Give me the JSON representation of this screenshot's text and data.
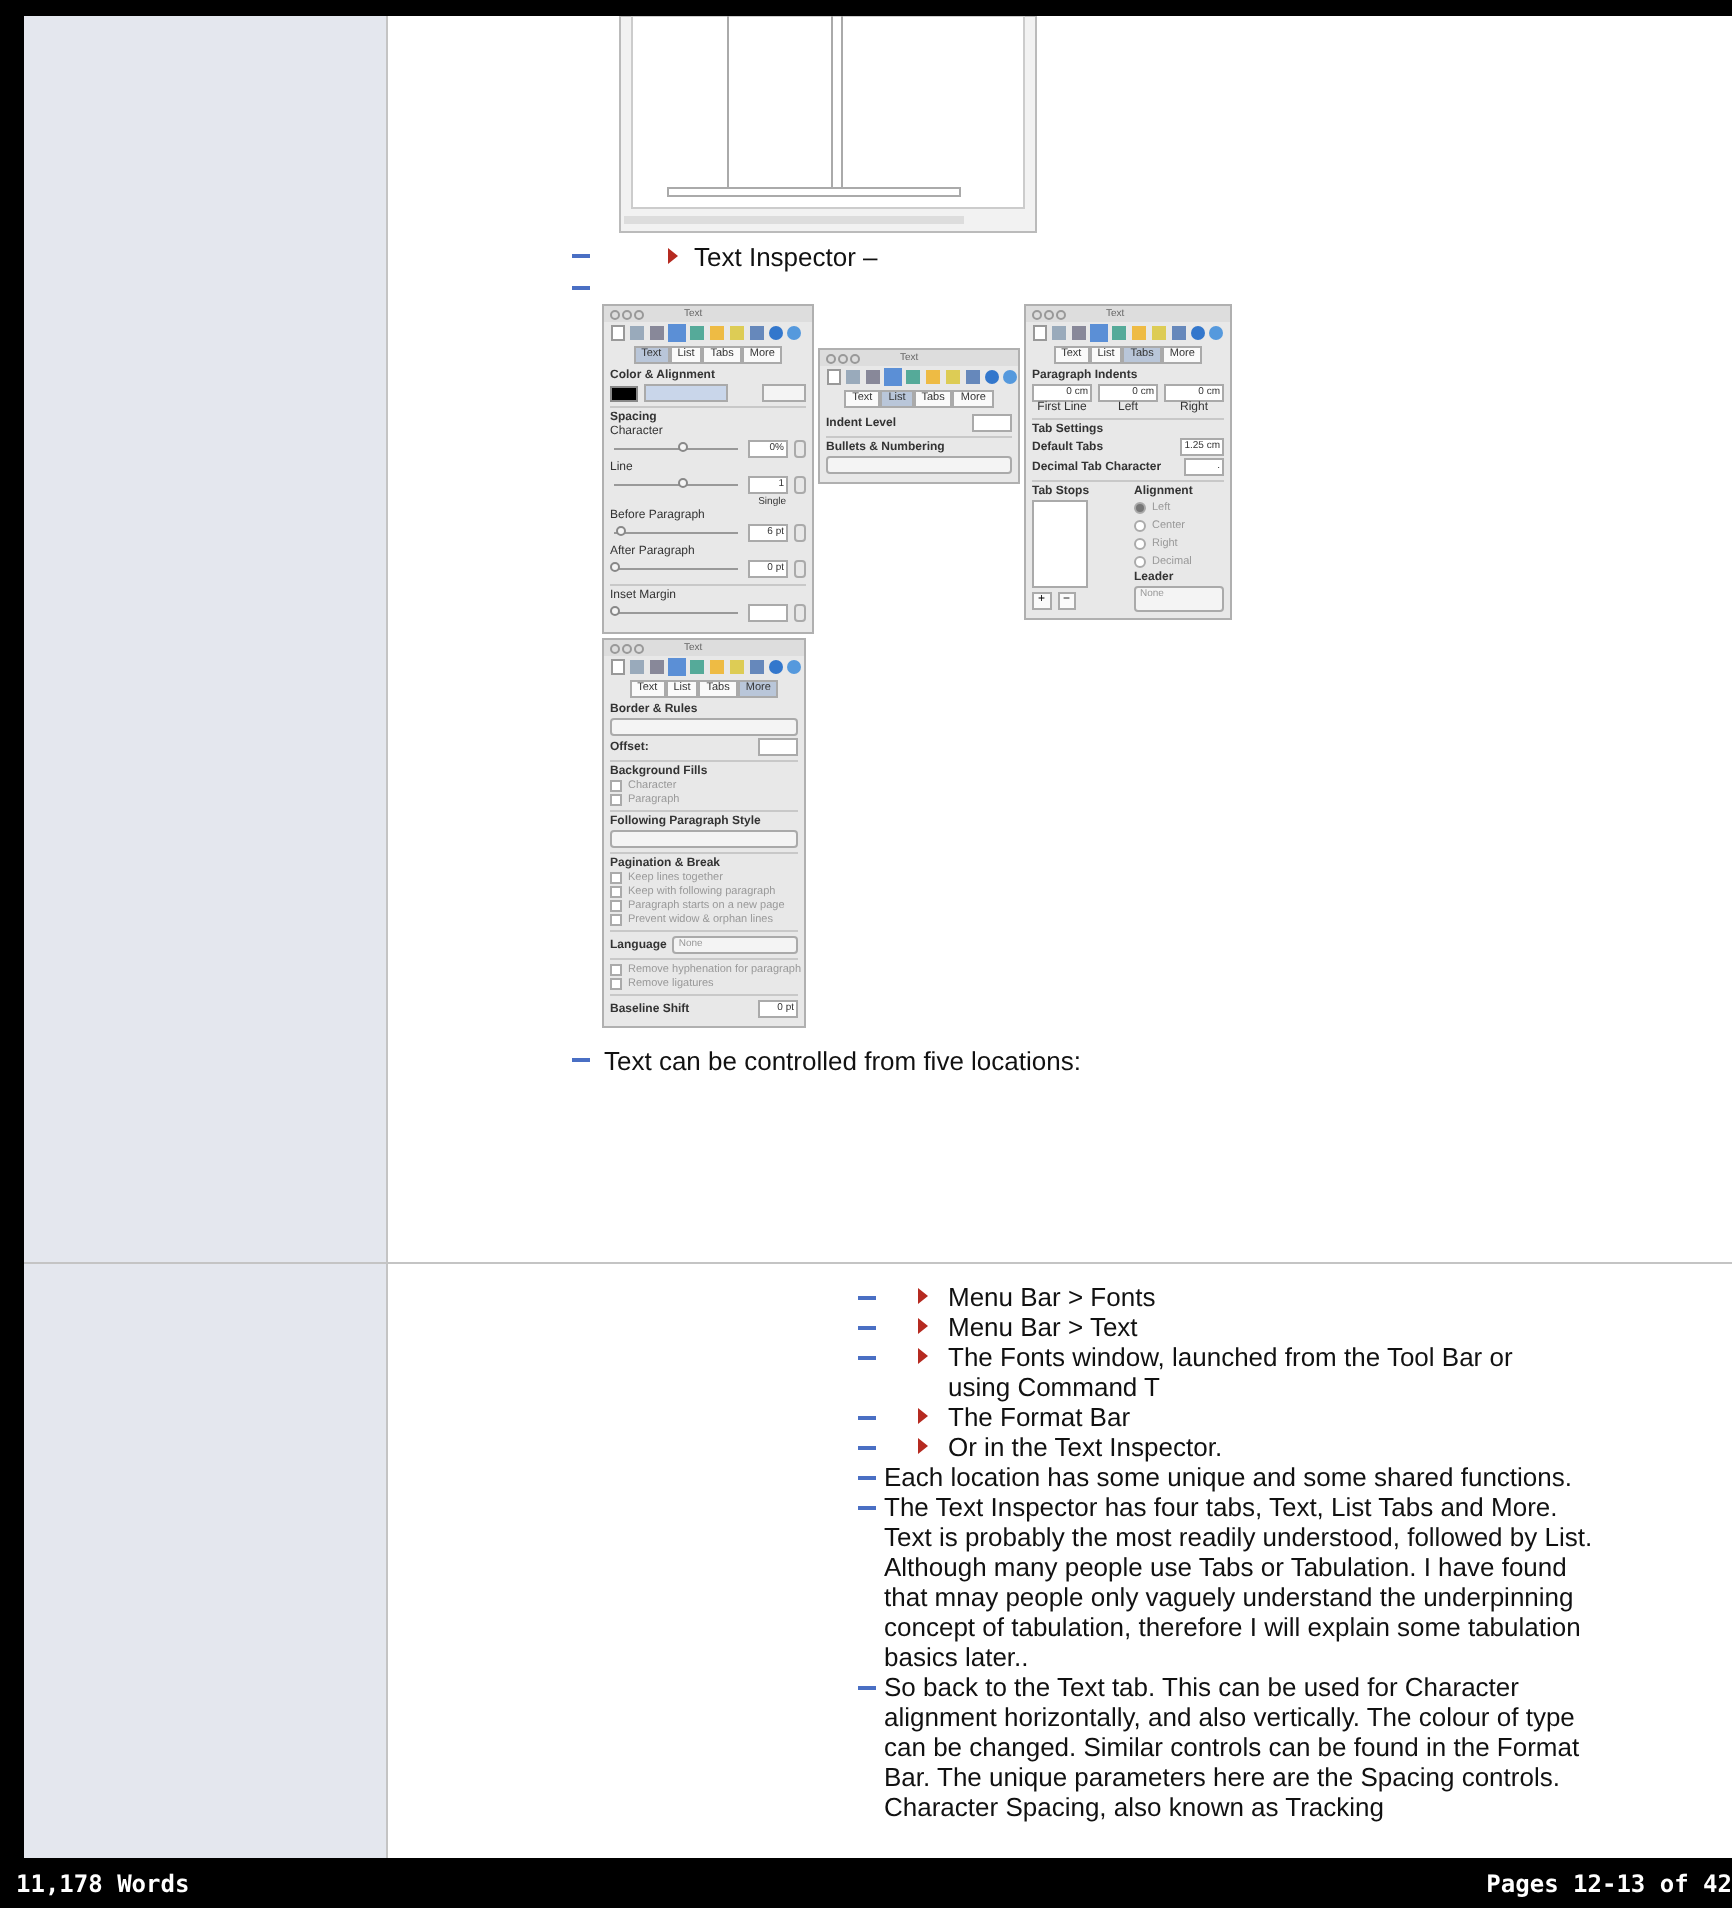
{
  "upper_section": {
    "items": [
      {
        "kind": "subbullet",
        "text": "Text Inspector –"
      },
      {
        "kind": "empty_bullet"
      }
    ],
    "panels": [
      {
        "title": "Text",
        "tabs": [
          {
            "label": "Text",
            "selected": true
          },
          {
            "label": "List",
            "selected": false
          },
          {
            "label": "Tabs",
            "selected": false
          },
          {
            "label": "More",
            "selected": false
          }
        ],
        "rows": [
          {
            "kind": "heading",
            "text": "Color & Alignment"
          },
          {
            "kind": "colorrow"
          },
          {
            "kind": "divider"
          },
          {
            "kind": "heading",
            "text": "Spacing"
          },
          {
            "kind": "slider",
            "label": "Character",
            "level": 0.55,
            "value": "0%"
          },
          {
            "kind": "slider",
            "label": "Line",
            "level": 0.55,
            "value": "1",
            "note": "Single"
          },
          {
            "kind": "slider",
            "label": "Before Paragraph",
            "level": 0.05,
            "value": "6 pt"
          },
          {
            "kind": "slider",
            "label": "After Paragraph",
            "level": 0.0,
            "value": "0 pt"
          },
          {
            "kind": "divider"
          },
          {
            "kind": "slider",
            "label": "Inset Margin",
            "level": 0.0
          }
        ]
      },
      {
        "title": "Text",
        "tabs": [
          {
            "label": "Text",
            "selected": false
          },
          {
            "label": "List",
            "selected": true
          },
          {
            "label": "Tabs",
            "selected": false
          },
          {
            "label": "More",
            "selected": false
          }
        ],
        "rows": [
          {
            "kind": "field",
            "label": "Indent Level"
          },
          {
            "kind": "divider"
          },
          {
            "kind": "heading",
            "text": "Bullets & Numbering"
          },
          {
            "kind": "select"
          }
        ]
      },
      {
        "title": "Text",
        "tabs": [
          {
            "label": "Text",
            "selected": false
          },
          {
            "label": "List",
            "selected": false
          },
          {
            "label": "Tabs",
            "selected": true
          },
          {
            "label": "More",
            "selected": false
          }
        ],
        "rows": [
          {
            "kind": "heading",
            "text": "Paragraph Indents"
          },
          {
            "kind": "fields3",
            "items": [
              {
                "value": "0 cm",
                "label": "First Line"
              },
              {
                "value": "0 cm",
                "label": "Left"
              },
              {
                "value": "0 cm",
                "label": "Right"
              }
            ]
          },
          {
            "kind": "divider"
          },
          {
            "kind": "heading",
            "text": "Tab Settings"
          },
          {
            "kind": "field",
            "label": "Default Tabs",
            "value": "1.25 cm"
          },
          {
            "kind": "field",
            "label": "Decimal Tab Character",
            "value": "."
          },
          {
            "kind": "divider"
          },
          {
            "kind": "tabstops",
            "label": "Tab Stops",
            "alignment_label": "Alignment",
            "options": [
              {
                "label": "Left",
                "selected": true
              },
              {
                "label": "Center",
                "selected": false
              },
              {
                "label": "Right",
                "selected": false
              },
              {
                "label": "Decimal",
                "selected": false
              }
            ],
            "leader_label": "Leader",
            "leader_value": "None",
            "buttons": [
              "+",
              "−"
            ]
          }
        ]
      }
    ],
    "more_panel": {
      "title": "Text",
      "tabs": [
        {
          "label": "Text",
          "selected": false
        },
        {
          "label": "List",
          "selected": false
        },
        {
          "label": "Tabs",
          "selected": false
        },
        {
          "label": "More",
          "selected": true
        }
      ],
      "rows": [
        {
          "kind": "heading",
          "text": "Border & Rules"
        },
        {
          "kind": "select"
        },
        {
          "kind": "field",
          "label": "Offset:"
        },
        {
          "kind": "divider"
        },
        {
          "kind": "heading",
          "text": "Background Fills"
        },
        {
          "kind": "checkbox",
          "label": "Character",
          "checked": false
        },
        {
          "kind": "checkbox",
          "label": "Paragraph",
          "checked": false
        },
        {
          "kind": "divider"
        },
        {
          "kind": "heading",
          "text": "Following Paragraph Style"
        },
        {
          "kind": "select"
        },
        {
          "kind": "divider"
        },
        {
          "kind": "heading",
          "text": "Pagination & Break"
        },
        {
          "kind": "checkbox",
          "label": "Keep lines together",
          "checked": false
        },
        {
          "kind": "checkbox",
          "label": "Keep with following paragraph",
          "checked": false
        },
        {
          "kind": "checkbox",
          "label": "Paragraph starts on a new page",
          "checked": false
        },
        {
          "kind": "checkbox",
          "label": "Prevent widow & orphan lines",
          "checked": false
        },
        {
          "kind": "divider"
        },
        {
          "kind": "select",
          "label": "Language",
          "value": "None"
        },
        {
          "kind": "divider"
        },
        {
          "kind": "checkbox",
          "label": "Remove hyphenation for paragraph",
          "checked": false
        },
        {
          "kind": "checkbox",
          "label": "Remove ligatures",
          "checked": false
        },
        {
          "kind": "divider"
        },
        {
          "kind": "field",
          "label": "Baseline Shift",
          "value": "0 pt"
        }
      ]
    },
    "closing_bullet": "Text can be controlled from five locations:"
  },
  "lower_section": {
    "items": [
      {
        "kind": "subbullet",
        "text": "Menu Bar > Fonts"
      },
      {
        "kind": "subbullet",
        "text": "Menu Bar > Text"
      },
      {
        "kind": "subbullet",
        "text": "The Fonts window, launched from the Tool Bar or using Command T"
      },
      {
        "kind": "subbullet",
        "text": "The Format Bar"
      },
      {
        "kind": "subbullet",
        "text": "Or in the Text Inspector."
      },
      {
        "kind": "bullet",
        "text": "Each location has some unique and some shared functions."
      },
      {
        "kind": "bullet",
        "text": "The Text Inspector has four tabs, Text, List Tabs and More. Text is probably the most readily understood, followed by List. Although many people use Tabs or Tabulation. I have found that mnay people only vaguely understand the underpinning concept of tabulation, therefore I will explain some tabulation basics later.."
      },
      {
        "kind": "bullet",
        "text": "So back to the Text tab. This can be used for Character alignment horizontally, and also vertically. The colour of type can be changed. Similar controls can be found in the Format Bar. The unique parameters here are the Spacing controls. Character Spacing, also known as Tracking"
      }
    ]
  },
  "status_bar": {
    "word_count": "11,178 Words",
    "pages": "Pages 12-13 of 42"
  }
}
